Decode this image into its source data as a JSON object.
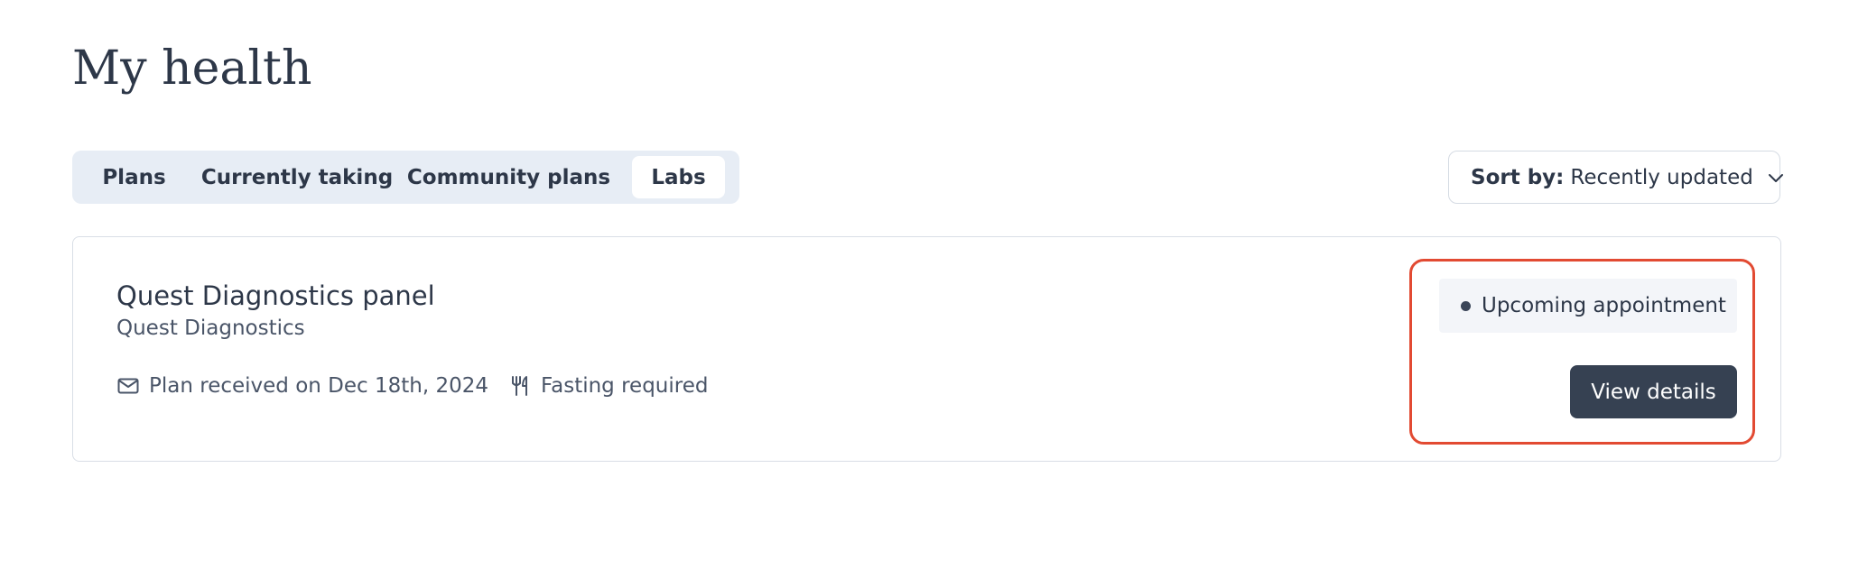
{
  "header": {
    "title": "My health"
  },
  "tabs": [
    {
      "label": "Plans",
      "selected": false
    },
    {
      "label": "Currently taking",
      "selected": false
    },
    {
      "label": "Community plans",
      "selected": false
    },
    {
      "label": "Labs",
      "selected": true
    }
  ],
  "sort": {
    "label": "Sort by:",
    "value": "Recently updated",
    "icon": "chevron-down-icon"
  },
  "card": {
    "title": "Quest Diagnostics panel",
    "provider": "Quest Diagnostics",
    "meta": [
      {
        "icon": "envelope-icon",
        "text": "Plan received on Dec 18th, 2024"
      },
      {
        "icon": "fork-knife-icon",
        "text": "Fasting required"
      }
    ],
    "status": {
      "text": "Upcoming appointment"
    },
    "action_label": "View details"
  },
  "colors": {
    "tab_bar_background": "#e7edf5",
    "primary_button": "#364152",
    "highlight_outline": "#e24a32",
    "status_badge_background": "#f3f5f9"
  }
}
